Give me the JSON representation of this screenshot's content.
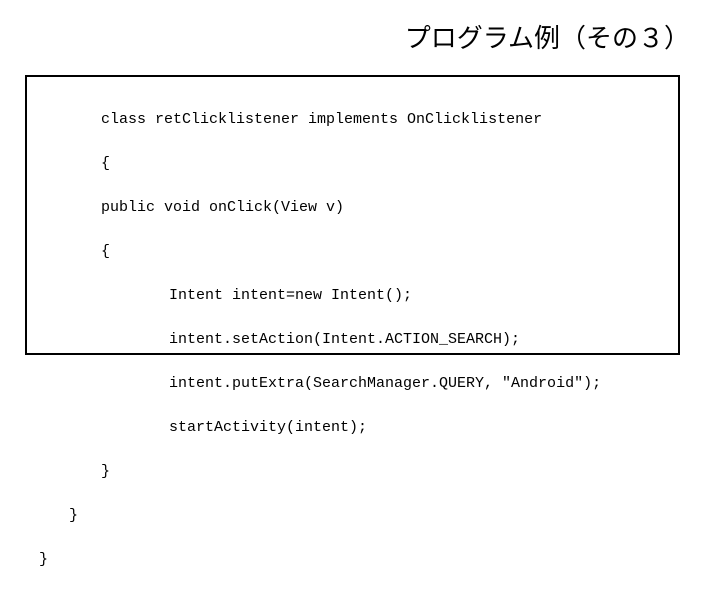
{
  "title": "プログラム例（その３）",
  "code": {
    "l1": "class retClicklistener implements OnClicklistener",
    "l2": "{",
    "l3": "public void onClick(View v)",
    "l4": "{",
    "l5": "Intent intent=new Intent();",
    "l6": "intent.setAction(Intent.ACTION_SEARCH);",
    "l7": "intent.putExtra(SearchManager.QUERY, \"Android\");",
    "l8": "startActivity(intent);",
    "l9": "}",
    "l10": "}",
    "l11": "}"
  }
}
